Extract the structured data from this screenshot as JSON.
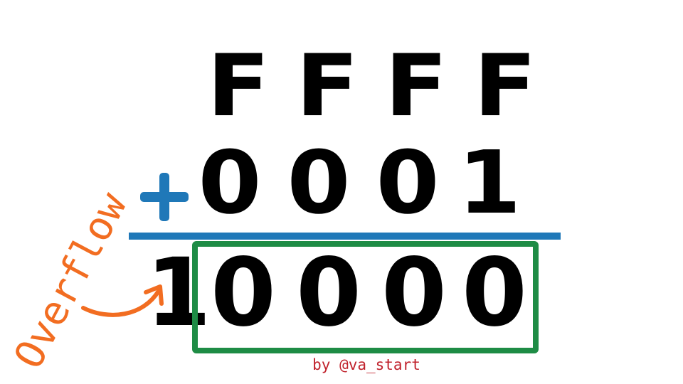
{
  "addend_top": [
    "F",
    "F",
    "F",
    "F"
  ],
  "operator": "+",
  "addend_bottom": [
    "0",
    "0",
    "0",
    "1"
  ],
  "carry_digit": "1",
  "result_digits": [
    "0",
    "0",
    "0",
    "0"
  ],
  "overflow_label": "Overflow",
  "credit": "by @va_start",
  "colors": {
    "digits": "#000000",
    "plus_and_line": "#1f78b8",
    "result_box": "#1e8c45",
    "overflow": "#f26d21",
    "credit": "#c0222c"
  }
}
